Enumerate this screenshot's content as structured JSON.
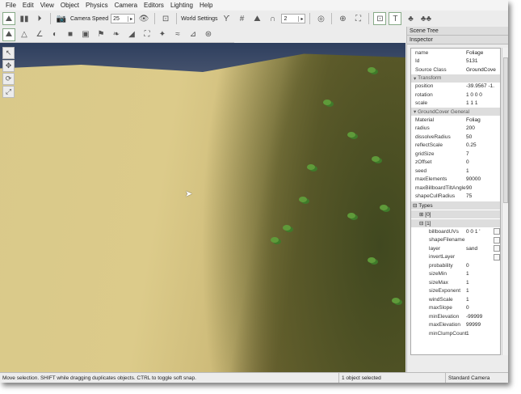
{
  "menu": [
    "File",
    "Edit",
    "View",
    "Object",
    "Physics",
    "Camera",
    "Editors",
    "Lighting",
    "Help"
  ],
  "toolbar": {
    "camera_speed_label": "Camera Speed",
    "camera_speed_value": "25",
    "world_settings_label": "World Settings",
    "snap_value": "2"
  },
  "panels": {
    "scene_tree": "Scene Tree",
    "inspector": "Inspector"
  },
  "inspector": {
    "top": [
      {
        "k": "name",
        "v": "Foliage"
      },
      {
        "k": "Id",
        "v": "5131"
      },
      {
        "k": "Source Class",
        "v": "GroundCove"
      }
    ],
    "transform_title": "Transform",
    "transform": [
      {
        "k": "position",
        "v": "-39.9567 -1."
      },
      {
        "k": "rotation",
        "v": "1 0 0 0"
      },
      {
        "k": "scale",
        "v": "1 1 1"
      }
    ],
    "general_title": "GroundCover General",
    "general": [
      {
        "k": "Material",
        "v": "Foliag"
      },
      {
        "k": "radius",
        "v": "200"
      },
      {
        "k": "dissolveRadius",
        "v": "50"
      },
      {
        "k": "reflectScale",
        "v": "0.25"
      },
      {
        "k": "gridSize",
        "v": "7"
      },
      {
        "k": "zOffset",
        "v": "0"
      },
      {
        "k": "seed",
        "v": "1"
      },
      {
        "k": "maxElements",
        "v": "90000"
      },
      {
        "k": "maxBillboardTiltAngle",
        "v": "90"
      },
      {
        "k": "shapeCullRadius",
        "v": "75"
      }
    ],
    "types_label": "Types",
    "type0": "[0]",
    "type1": "[1]",
    "type1_props": [
      {
        "k": "billboardUVs",
        "v": "0 0 1 '"
      },
      {
        "k": "shapeFilename",
        "v": ""
      },
      {
        "k": "layer",
        "v": "sand"
      },
      {
        "k": "invertLayer",
        "v": ""
      },
      {
        "k": "probability",
        "v": "0"
      },
      {
        "k": "sizeMin",
        "v": "1"
      },
      {
        "k": "sizeMax",
        "v": "1"
      },
      {
        "k": "sizeExponent",
        "v": "1"
      },
      {
        "k": "windScale",
        "v": "1"
      },
      {
        "k": "maxSlope",
        "v": "0"
      },
      {
        "k": "minElevation",
        "v": "-99999"
      },
      {
        "k": "maxElevation",
        "v": "99999"
      },
      {
        "k": "minClumpCount",
        "v": "1"
      }
    ]
  },
  "status": {
    "hint": "Move selection.  SHIFT while dragging duplicates objects.  CTRL to toggle soft snap.",
    "selection": "1 object selected",
    "camera": "Standard Camera"
  }
}
